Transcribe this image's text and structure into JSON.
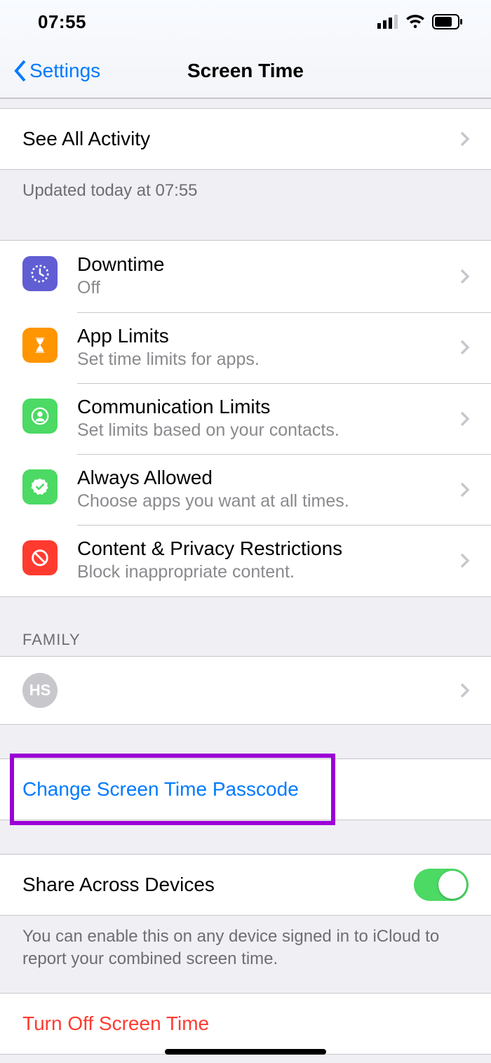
{
  "status": {
    "time": "07:55"
  },
  "nav": {
    "back": "Settings",
    "title": "Screen Time"
  },
  "activity": {
    "see_all": "See All Activity",
    "updated": "Updated today at 07:55"
  },
  "features": [
    {
      "title": "Downtime",
      "subtitle": "Off",
      "icon": "clock-icon",
      "color": "purple"
    },
    {
      "title": "App Limits",
      "subtitle": "Set time limits for apps.",
      "icon": "hourglass-icon",
      "color": "orange"
    },
    {
      "title": "Communication Limits",
      "subtitle": "Set limits based on your contacts.",
      "icon": "contact-icon",
      "color": "green"
    },
    {
      "title": "Always Allowed",
      "subtitle": "Choose apps you want at all times.",
      "icon": "check-badge-icon",
      "color": "green2"
    },
    {
      "title": "Content & Privacy Restrictions",
      "subtitle": "Block inappropriate content.",
      "icon": "no-entry-icon",
      "color": "red"
    }
  ],
  "family": {
    "header": "FAMILY",
    "member_initials": "HS"
  },
  "passcode": {
    "label": "Change Screen Time Passcode"
  },
  "share": {
    "label": "Share Across Devices",
    "on": true,
    "footer": "You can enable this on any device signed in to iCloud to report your combined screen time."
  },
  "turn_off": {
    "label": "Turn Off Screen Time"
  },
  "colors": {
    "accent": "#007aff",
    "destructive": "#ff3b30",
    "toggle_on": "#4cd964",
    "highlight": "#9b00d6"
  }
}
